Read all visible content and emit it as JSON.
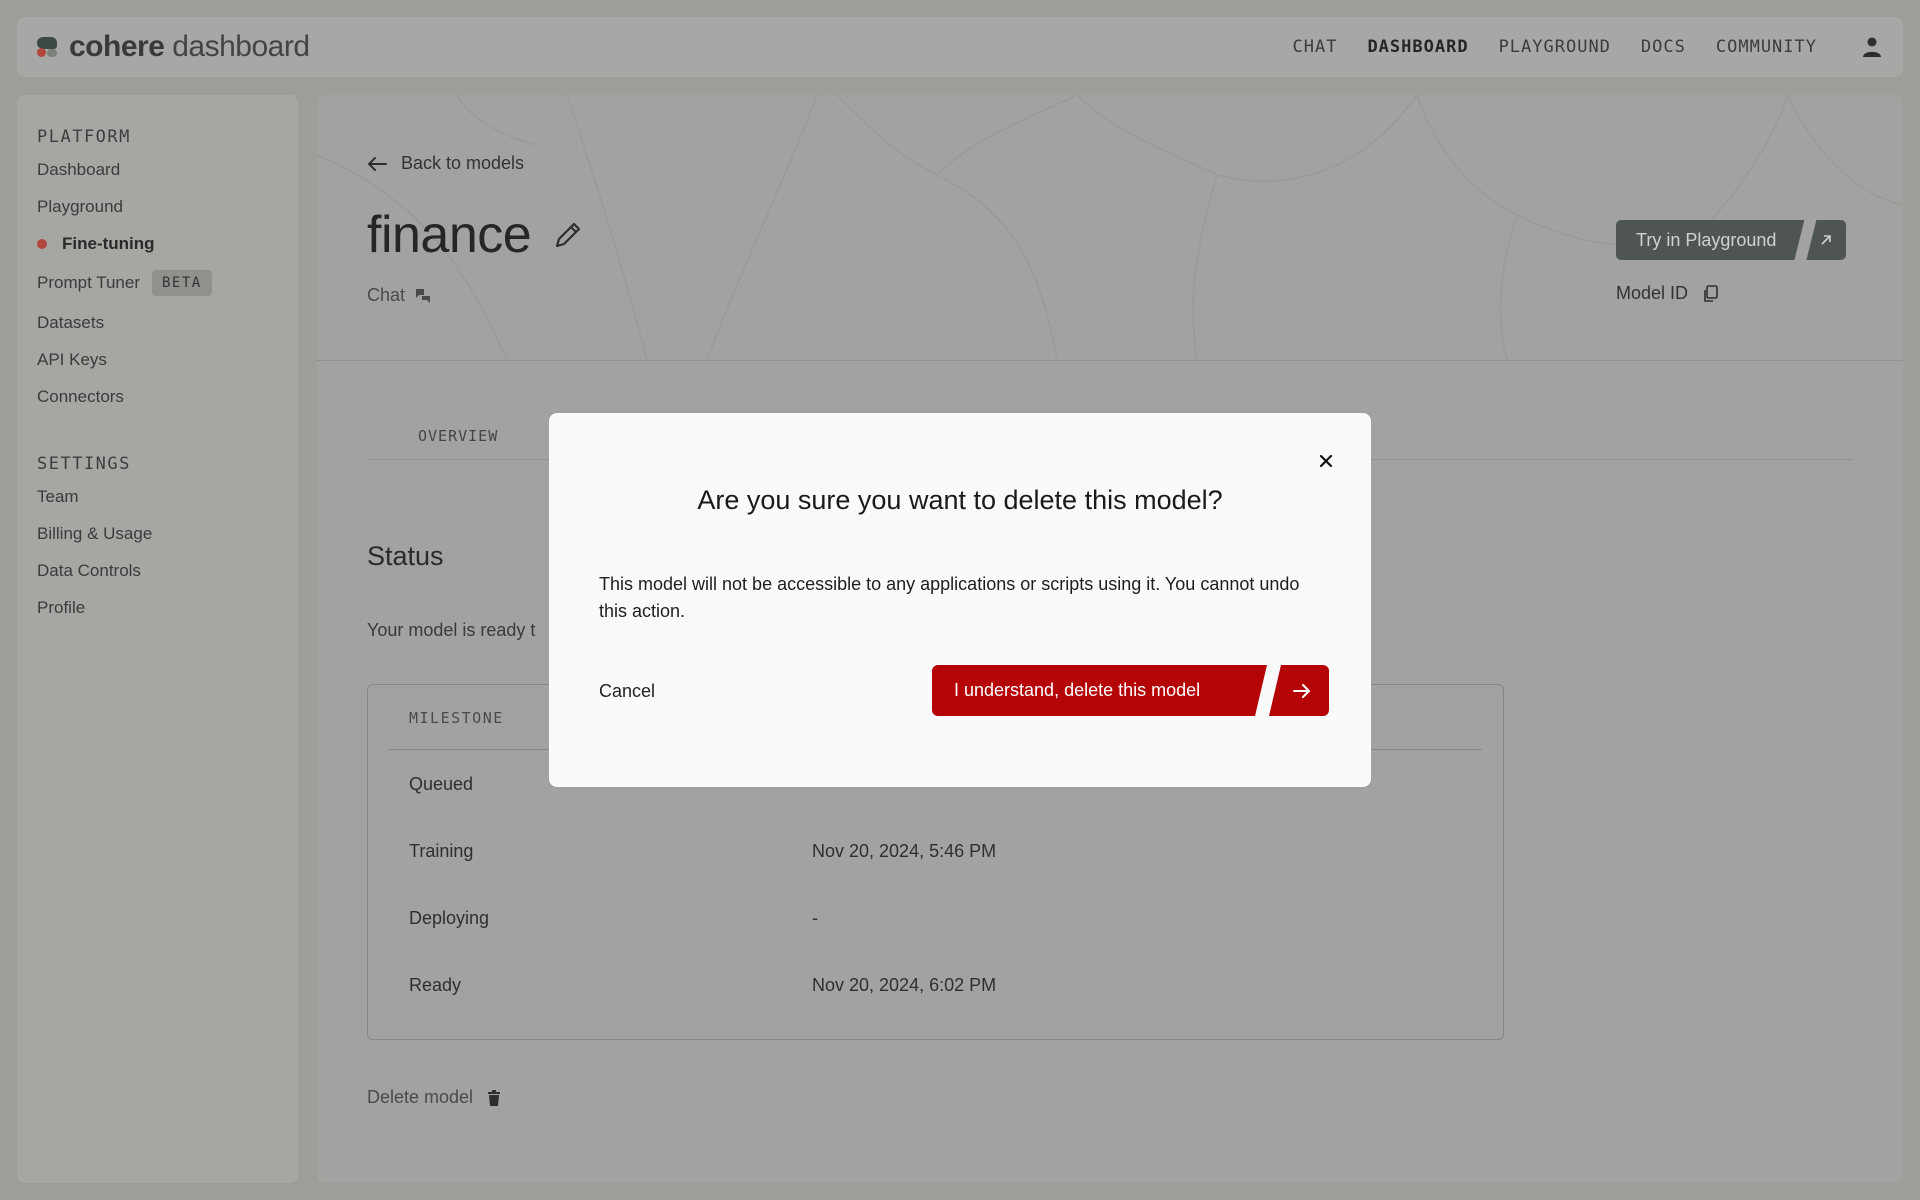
{
  "header": {
    "logo_word1": "cohere",
    "logo_word2": "dashboard",
    "nav": [
      "CHAT",
      "DASHBOARD",
      "PLAYGROUND",
      "DOCS",
      "COMMUNITY"
    ],
    "active_nav": "DASHBOARD",
    "user_icon": "user-icon"
  },
  "sidebar": {
    "platform_label": "PLATFORM",
    "platform_items": [
      "Dashboard",
      "Playground",
      "Fine-tuning",
      "Prompt Tuner",
      "Datasets",
      "API Keys",
      "Connectors"
    ],
    "active_item": "Fine-tuning",
    "beta_badge": "BETA",
    "settings_label": "SETTINGS",
    "settings_items": [
      "Team",
      "Billing & Usage",
      "Data Controls",
      "Profile"
    ]
  },
  "model": {
    "back_label": "Back to models",
    "name": "finance",
    "type": "Chat",
    "try_button": "Try in Playground",
    "model_id_label": "Model ID"
  },
  "tabs": {
    "overview": "OVERVIEW"
  },
  "status": {
    "title": "Status",
    "message_visible": "Your model is ready t",
    "milestone_header": "MILESTONE",
    "rows": [
      {
        "label": "Queued",
        "date": ""
      },
      {
        "label": "Training",
        "date": "Nov 20, 2024, 5:46 PM"
      },
      {
        "label": "Deploying",
        "date": "-"
      },
      {
        "label": "Ready",
        "date": "Nov 20, 2024, 6:02 PM"
      }
    ],
    "delete_label": "Delete model"
  },
  "modal": {
    "title": "Are you sure you want to delete this model?",
    "body": "This model will not be accessible to any applications or scripts using it. You cannot undo this action.",
    "cancel": "Cancel",
    "confirm": "I understand, delete this model"
  },
  "colors": {
    "danger": "#b50405",
    "active_dot": "#b3473e",
    "try_button_bg": "#4f5652"
  }
}
